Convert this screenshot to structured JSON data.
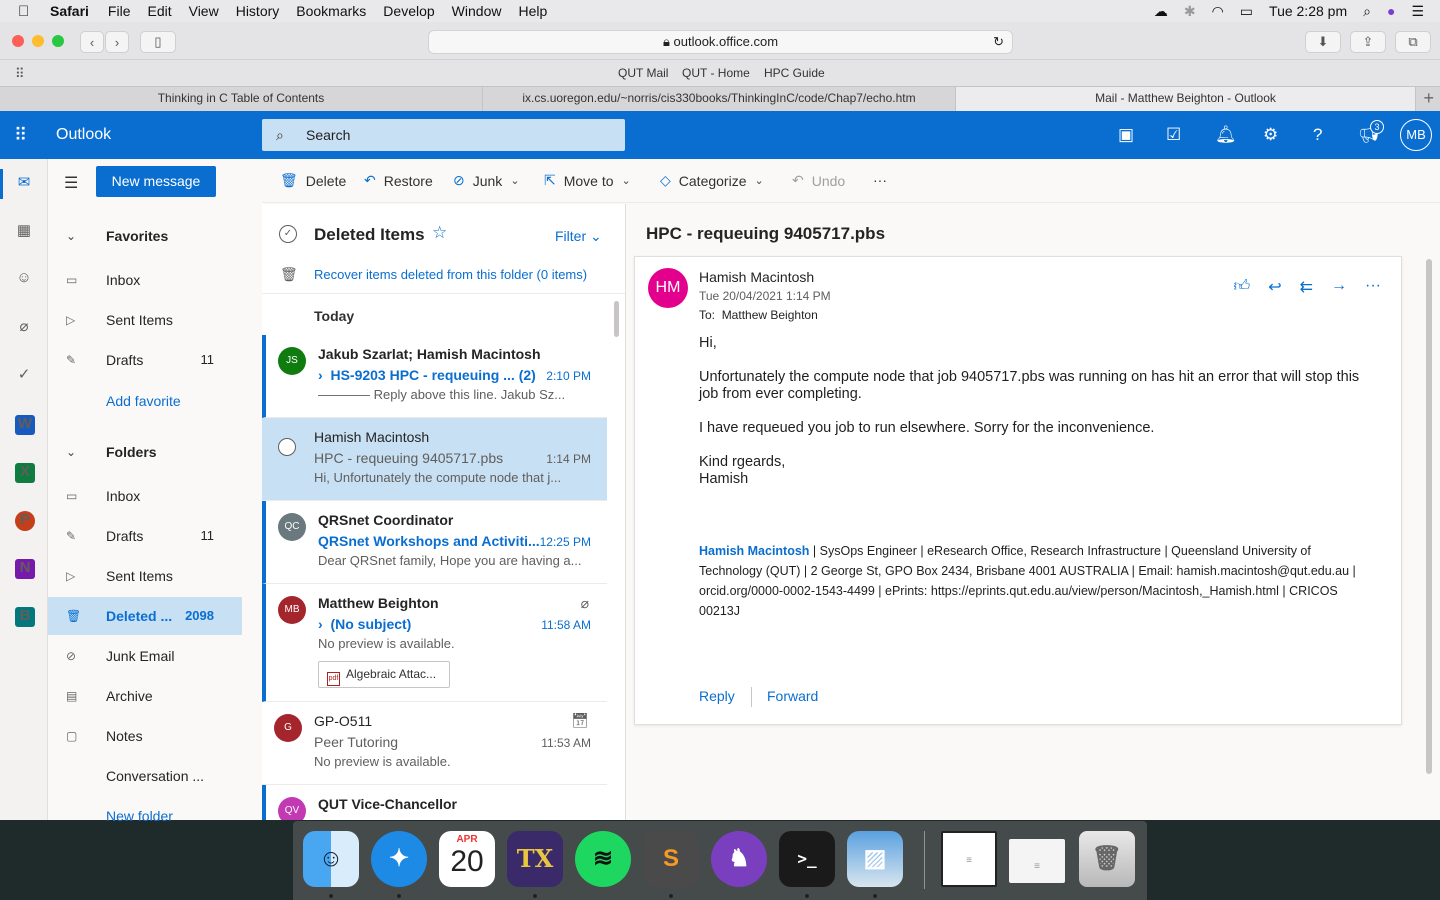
{
  "menubar": {
    "app": "Safari",
    "items": [
      "File",
      "Edit",
      "View",
      "History",
      "Bookmarks",
      "Develop",
      "Window",
      "Help"
    ],
    "clock": "Tue 2:28 pm"
  },
  "browser": {
    "url": "outlook.office.com",
    "bookmarks": [
      "QUT Mail",
      "QUT - Home",
      "HPC Guide"
    ],
    "tabs": [
      "Thinking in C Table of Contents",
      "ix.cs.uoregon.edu/~norris/cis330books/ThinkingInC/code/Chap7/echo.htm",
      "Mail - Matthew Beighton - Outlook"
    ]
  },
  "outlook": {
    "title": "Outlook",
    "search_placeholder": "Search",
    "notif_count": "3",
    "user_initials": "MB"
  },
  "nav": {
    "new_message": "New message",
    "favorites_label": "Favorites",
    "favorites": [
      {
        "label": "Inbox",
        "count": ""
      },
      {
        "label": "Sent Items",
        "count": ""
      },
      {
        "label": "Drafts",
        "count": "11"
      }
    ],
    "add_favorite": "Add favorite",
    "folders_label": "Folders",
    "folders": [
      {
        "label": "Inbox",
        "count": ""
      },
      {
        "label": "Drafts",
        "count": "11"
      },
      {
        "label": "Sent Items",
        "count": ""
      },
      {
        "label": "Deleted ...",
        "count": "2098"
      },
      {
        "label": "Junk Email",
        "count": ""
      },
      {
        "label": "Archive",
        "count": ""
      },
      {
        "label": "Notes",
        "count": ""
      },
      {
        "label": "Conversation ...",
        "count": ""
      }
    ],
    "new_folder": "New folder"
  },
  "commands": {
    "delete": "Delete",
    "restore": "Restore",
    "junk": "Junk",
    "move_to": "Move to",
    "categorize": "Categorize",
    "undo": "Undo",
    "more": "···"
  },
  "list": {
    "folder_title": "Deleted Items",
    "filter": "Filter",
    "recover": "Recover items deleted from this folder (0 items)",
    "group": "Today",
    "messages": [
      {
        "initials": "JS",
        "from": "Jakub Szarlat; Hamish Macintosh",
        "subject": "HS-9203 HPC - requeuing ...  (2)",
        "time": "2:10 PM",
        "preview": "———— Reply above this line. Jakub Sz...",
        "color": "#107c10"
      },
      {
        "initials": "",
        "from": "Hamish Macintosh",
        "subject": "HPC - requeuing 9405717.pbs",
        "time": "1:14 PM",
        "preview": "Hi, Unfortunately the compute node that j...",
        "color": ""
      },
      {
        "initials": "QC",
        "from": "QRSnet Coordinator",
        "subject": "QRSnet Workshops and Activiti...",
        "time": "12:25 PM",
        "preview": "Dear QRSnet family, Hope you are having a...",
        "color": "#69797e"
      },
      {
        "initials": "MB",
        "from": "Matthew Beighton",
        "subject": "(No subject)",
        "time": "11:58 AM",
        "preview": "No preview is available.",
        "attachment": "Algebraic Attac...",
        "color": "#a4262c"
      },
      {
        "initials": "G",
        "from": "GP-O511",
        "subject": "Peer Tutoring",
        "time": "11:53 AM",
        "preview": "No preview is available.",
        "color": "#a4262c"
      },
      {
        "initials": "QV",
        "from": "QUT Vice-Chancellor",
        "subject": "",
        "time": "",
        "preview": "",
        "color": "#c239b3"
      }
    ]
  },
  "reading": {
    "subject": "HPC - requeuing 9405717.pbs",
    "initials": "HM",
    "sender": "Hamish Macintosh",
    "date": "Tue 20/04/2021 1:14 PM",
    "to_label": "To:",
    "to": "Matthew Beighton",
    "body": [
      "Hi,",
      "Unfortunately the compute node that job 9405717.pbs was running on has hit an error that will stop this job from ever completing.",
      "I have requeued you job to run elsewhere. Sorry for the inconvenience.",
      "Kind rgeards,",
      "Hamish"
    ],
    "sig_name": "Hamish Macintosh",
    "sig_rest": " | SysOps Engineer | eResearch Office, Research Infrastructure | Queensland University of Technology (QUT) | 2 George St, GPO Box 2434, Brisbane 4001 AUSTRALIA |  Email: hamish.macintosh@qut.edu.au  | orcid.org/0000-0002-1543-4499 | ePrints: https://eprints.qut.edu.au/view/person/Macintosh,_Hamish.html | CRICOS 00213J",
    "reply": "Reply",
    "forward": "Forward"
  },
  "dock": {
    "calendar_month": "APR",
    "calendar_day": "20"
  },
  "colors": {
    "outlook_blue": "#0a6ed1",
    "selected_bg": "#c7e0f4",
    "avatar_hm": "#e3008c"
  }
}
